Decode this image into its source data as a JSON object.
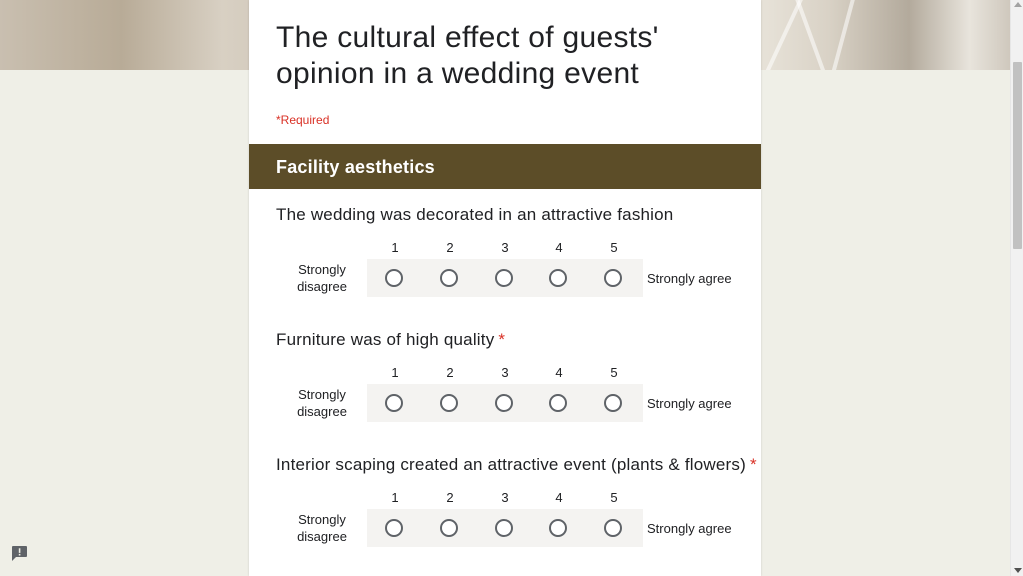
{
  "form": {
    "title": "The cultural effect of guests' opinion in a wedding event",
    "required_note": "*Required",
    "section_title": "Facility aesthetics",
    "scale_numbers": [
      "1",
      "2",
      "3",
      "4",
      "5"
    ],
    "questions": [
      {
        "title": "The wedding was decorated in an attractive fashion",
        "required": false,
        "low_label": "Strongly disagree",
        "high_label": "Strongly agree"
      },
      {
        "title": "Furniture was of high quality",
        "required": true,
        "low_label": "Strongly disagree",
        "high_label": "Strongly agree"
      },
      {
        "title": "Interior scaping created an attractive event (plants & flowers)",
        "required": true,
        "low_label": "Strongly disagree",
        "high_label": "Strongly agree"
      }
    ],
    "required_marker": "*"
  },
  "colors": {
    "section_header": "#5c4d28",
    "required_red": "#d93025",
    "page_background": "#efefe7",
    "card_background": "#ffffff",
    "radio_border": "#5f6368"
  },
  "icons": {
    "feedback": "report-feedback-icon"
  }
}
